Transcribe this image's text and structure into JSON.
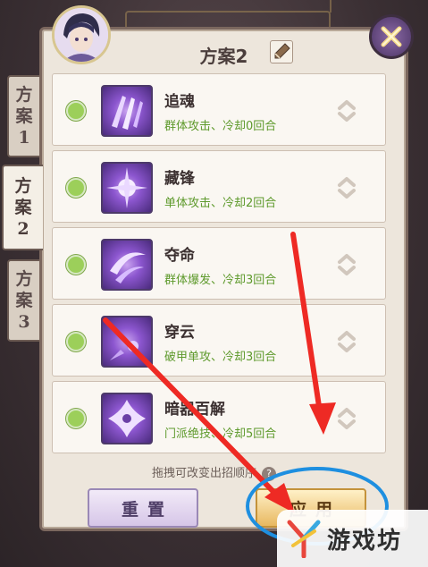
{
  "panel": {
    "title": "方案2"
  },
  "tabs": [
    {
      "label": "方案1",
      "line1": "方",
      "line2": "案",
      "line3": "1",
      "active": false
    },
    {
      "label": "方案2",
      "line1": "方",
      "line2": "案",
      "line3": "2",
      "active": true
    },
    {
      "label": "方案3",
      "line1": "方",
      "line2": "案",
      "line3": "3",
      "active": false
    }
  ],
  "skills": [
    {
      "name": "追魂",
      "desc": "群体攻击、冷却0回合",
      "icon": "claw-slash-icon"
    },
    {
      "name": "藏锋",
      "desc": "单体攻击、冷却2回合",
      "icon": "burst-blades-icon"
    },
    {
      "name": "夺命",
      "desc": "群体爆发、冷却3回合",
      "icon": "crescent-slash-icon"
    },
    {
      "name": "穿云",
      "desc": "破甲单攻、冷却3回合",
      "icon": "piercing-strike-icon"
    },
    {
      "name": "暗器百解",
      "desc": "门派绝技、冷却5回合",
      "icon": "shuriken-icon"
    }
  ],
  "hint": "拖拽可改变出招顺序",
  "hint_icon": "?",
  "buttons": {
    "reset": "重置",
    "apply": "应用"
  },
  "watermark": "游戏坊",
  "colors": {
    "accent_green": "#5e9a2c",
    "radio_green": "#9ccf5a",
    "arrow_red": "#ee2a24",
    "highlight_blue": "#1e8fe0"
  }
}
